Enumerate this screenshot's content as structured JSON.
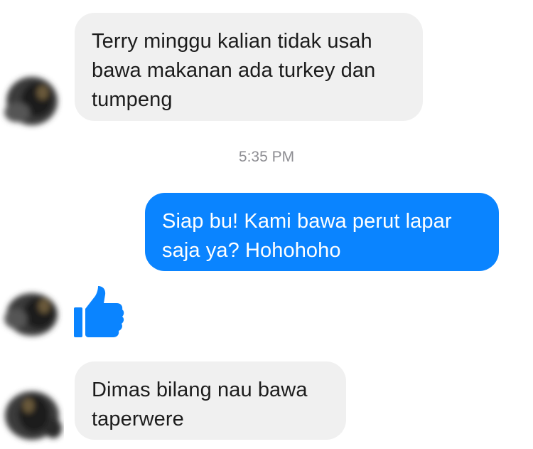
{
  "conversation": {
    "messages": [
      {
        "sender": "other",
        "text": "Terry minggu kalian tidak usah\nbawa makanan ada turkey dan\ntumpeng"
      },
      {
        "sender": "me",
        "text": "Siap bu! Kami bawa perut lapar\nsaja ya? Hohohoho"
      },
      {
        "sender": "other",
        "reaction_icon": "thumbs-up-icon"
      },
      {
        "sender": "other",
        "text": "Dimas bilang nau bawa\ntaperwere"
      }
    ],
    "timestamp": "5:35 PM"
  },
  "colors": {
    "outgoing_bubble": "#0a84ff",
    "incoming_bubble": "#f0f0f0",
    "timestamp_text": "#8e8e93",
    "thumbs_up": "#0a84ff"
  },
  "icons": {
    "avatar": "blurred-avatar-icon",
    "reaction": "thumbs-up-icon"
  }
}
